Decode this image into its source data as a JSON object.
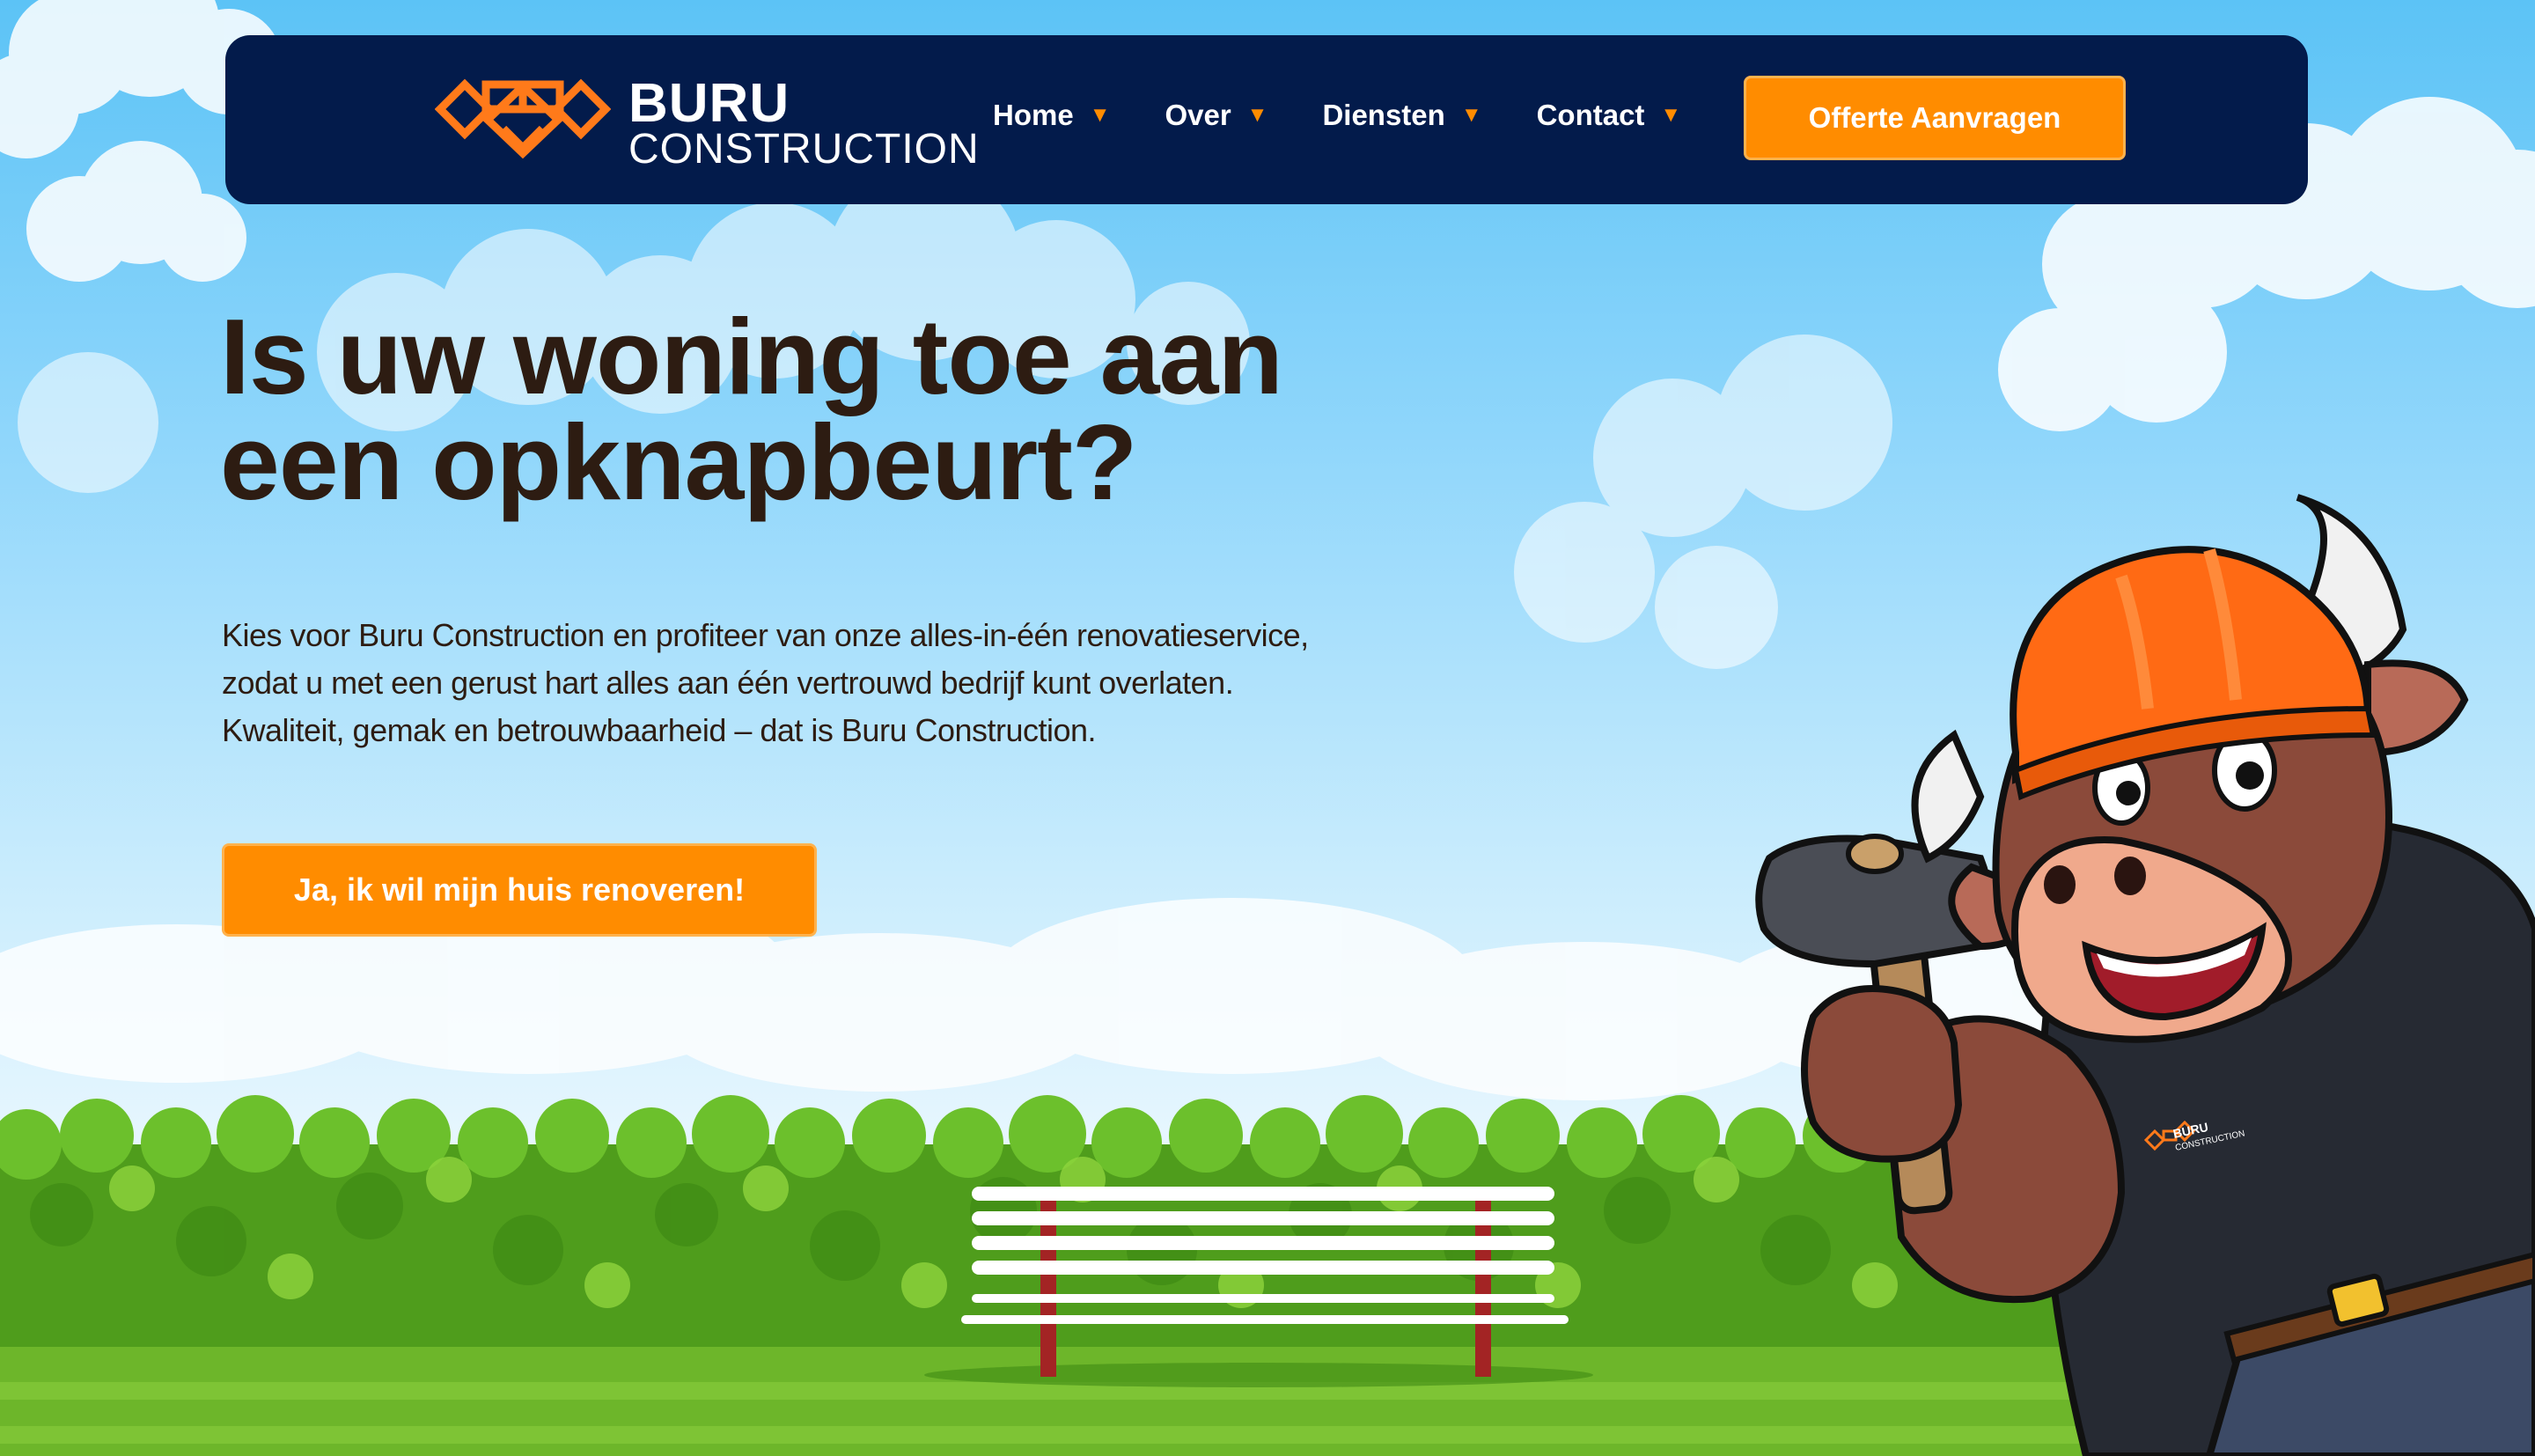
{
  "brand": {
    "name": "BURU",
    "subtitle": "CONSTRUCTION"
  },
  "nav": {
    "items": [
      {
        "label": "Home",
        "icon": "caret-down-icon"
      },
      {
        "label": "Over",
        "icon": "caret-down-icon"
      },
      {
        "label": "Diensten",
        "icon": "caret-down-icon"
      },
      {
        "label": "Contact",
        "icon": "caret-down-icon"
      }
    ],
    "caret": "▼",
    "cta_label": "Offerte Aanvragen"
  },
  "hero": {
    "title_line1": "Is uw woning toe aan",
    "title_line2": "een opknapbeurt?",
    "text_line1": "Kies voor Buru Construction en profiteer van onze alles-in-één renovatieservice,",
    "text_line2": "zodat u met een gerust hart alles aan één vertrouwd bedrijf kunt overlaten.",
    "text_line3": "Kwaliteit, gemak en betrouwbaarheid – dat is Buru Construction.",
    "cta_label": "Ja, ik wil mijn huis renoveren!"
  },
  "mascot": {
    "shirt_logo_name": "BURU",
    "shirt_logo_sub": "CONSTRUCTION"
  },
  "colors": {
    "navy": "#031b4b",
    "accent_orange": "#ff8c00",
    "heading_brown": "#2d1c12",
    "sky_top": "#5cc3f6",
    "hedge_green": "#4f9d1c",
    "grass_green": "#6db62a"
  }
}
